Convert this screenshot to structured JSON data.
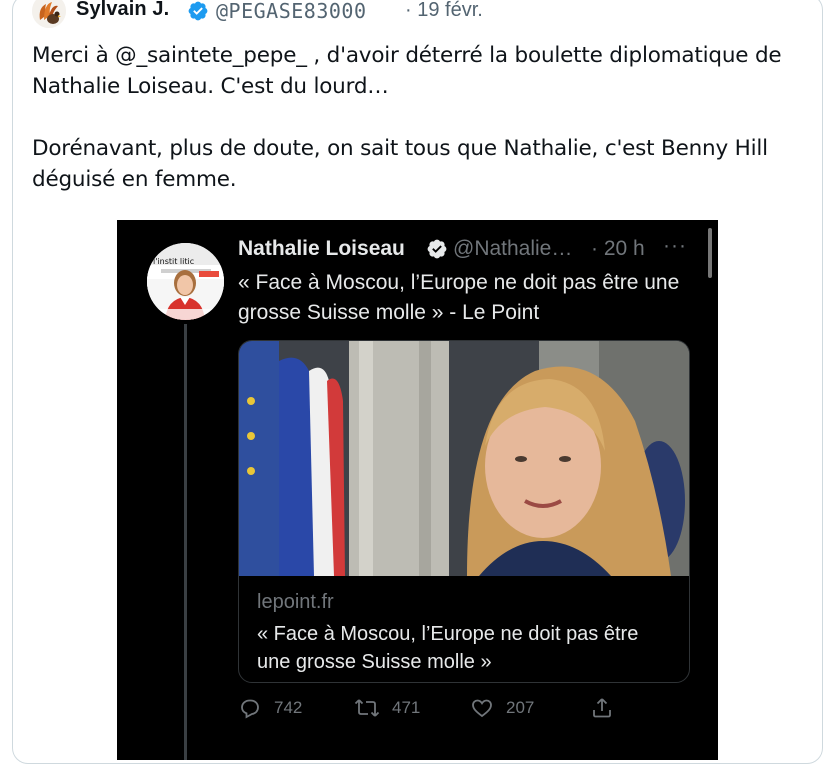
{
  "tweet": {
    "author_name": "Sylvain J.",
    "author_handle": "@PEGASE83000",
    "date": "· 19 févr.",
    "text": "Merci à @_saintete_pepe_ , d'avoir déterré la boulette diplomatique de\nNathalie Loiseau. C'est du lourd…\n\nDorénavant, plus de doute, on sait tous que Nathalie, c'est Benny Hill\ndéguisé en femme."
  },
  "screenshot": {
    "author_name": "Nathalie Loiseau",
    "author_handle": "@Nathalie…",
    "time": "· 20 h",
    "more": "···",
    "text": "« Face à Moscou, l’Europe ne doit pas être une grosse Suisse molle » - Le Point",
    "link_domain": "lepoint.fr",
    "link_title": "« Face à Moscou, l’Europe ne doit pas être une grosse Suisse molle »",
    "avatar_caption": "l'instit litic",
    "replies": "742",
    "retweets": "471",
    "likes": "207"
  },
  "colors": {
    "verified": "#1d9bf0",
    "muted": "#536471",
    "dark_bg": "#000000",
    "dark_text": "#e7e9ea"
  }
}
